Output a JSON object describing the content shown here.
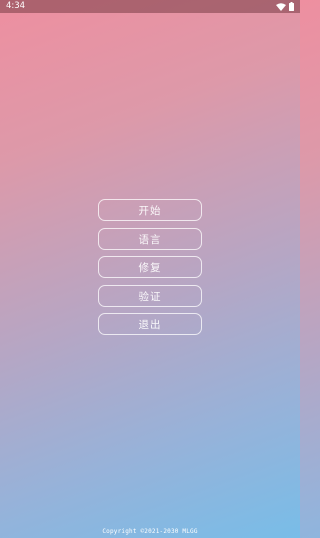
{
  "status_bar": {
    "time": "4:34",
    "icons": [
      "wifi-icon",
      "battery-icon"
    ]
  },
  "menu": {
    "items": [
      {
        "label": "开始"
      },
      {
        "label": "语言"
      },
      {
        "label": "修复"
      },
      {
        "label": "验证"
      },
      {
        "label": "退出"
      }
    ]
  },
  "footer": {
    "copyright": "Copyright ©2021-2030 MLGG"
  },
  "colors": {
    "gradient_top": "#ee8fa0",
    "gradient_bottom": "#78bde8",
    "button_border": "#ffffff"
  }
}
